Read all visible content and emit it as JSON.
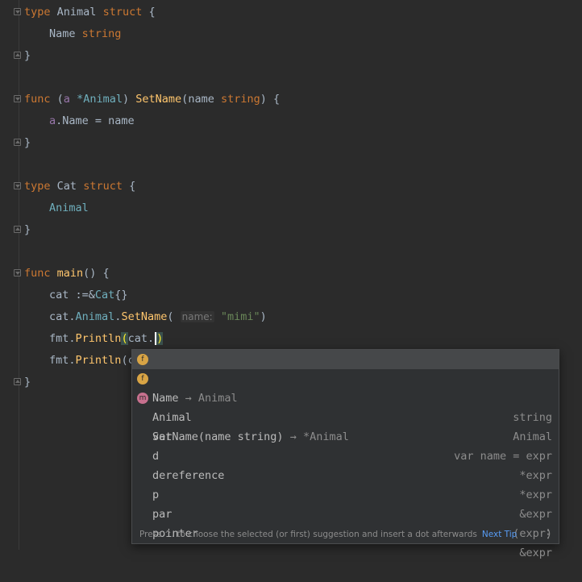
{
  "code": {
    "l1": {
      "kw": "type",
      "name": "Animal",
      "kw2": "struct",
      "brace": "{"
    },
    "l2": {
      "field": "Name",
      "type": "string"
    },
    "l3": {
      "brace": "}"
    },
    "l5": {
      "kw": "func",
      "recv_open": "(",
      "recv_name": "a",
      "recv_type": "*Animal",
      "recv_close": ")",
      "method": "SetName",
      "params_open": "(",
      "param_name": "name",
      "param_type": "string",
      "params_close": ")",
      "brace": "{"
    },
    "l6": {
      "recv": "a",
      "field": ".Name",
      "assign": " = name"
    },
    "l7": {
      "brace": "}"
    },
    "l9": {
      "kw": "type",
      "name": "Cat",
      "kw2": "struct",
      "brace": "{"
    },
    "l10": {
      "embedded": "Animal"
    },
    "l11": {
      "brace": "}"
    },
    "l13": {
      "kw": "func",
      "name": "main",
      "rest": "() {"
    },
    "l14": {
      "lhs": "cat :=&",
      "type": "Cat",
      "rest": "{}"
    },
    "l15": {
      "prefix": "cat.",
      "field": "Animal",
      "dot": ".",
      "method": "SetName",
      "open": "(",
      "hint": "name:",
      "arg": "\"mimi\"",
      "close": ")"
    },
    "l16": {
      "pkg": "fmt",
      "dot": ".",
      "fn": "Println",
      "open": "(",
      "arg": "cat.",
      "close": ")"
    },
    "l17": {
      "pkg": "fmt",
      "dot": ".",
      "fn": "Println",
      "open": "(",
      "arg": "c"
    },
    "l18": {
      "brace": "}"
    }
  },
  "completion": {
    "items": [
      {
        "icon": "f",
        "label": "Name",
        "suffix": "→ Animal",
        "right": "string"
      },
      {
        "icon": "f",
        "label": "Animal",
        "suffix": "",
        "right": "Animal"
      },
      {
        "icon": "m",
        "label": "SetName(name string)",
        "suffix": "→ *Animal",
        "right": ""
      },
      {
        "icon": "",
        "label": "var",
        "suffix": "",
        "right": "var name = expr"
      },
      {
        "icon": "",
        "label": "d",
        "suffix": "",
        "right": "*expr"
      },
      {
        "icon": "",
        "label": "dereference",
        "suffix": "",
        "right": "*expr"
      },
      {
        "icon": "",
        "label": "p",
        "suffix": "",
        "right": "&expr"
      },
      {
        "icon": "",
        "label": "par",
        "suffix": "",
        "right": "(expr)"
      },
      {
        "icon": "",
        "label": "pointer",
        "suffix": "",
        "right": "&expr"
      }
    ],
    "footer": "Press ^. to choose the selected (or first) suggestion and insert a dot afterwards",
    "next_tip": "Next Tip",
    "more": "⋮"
  }
}
